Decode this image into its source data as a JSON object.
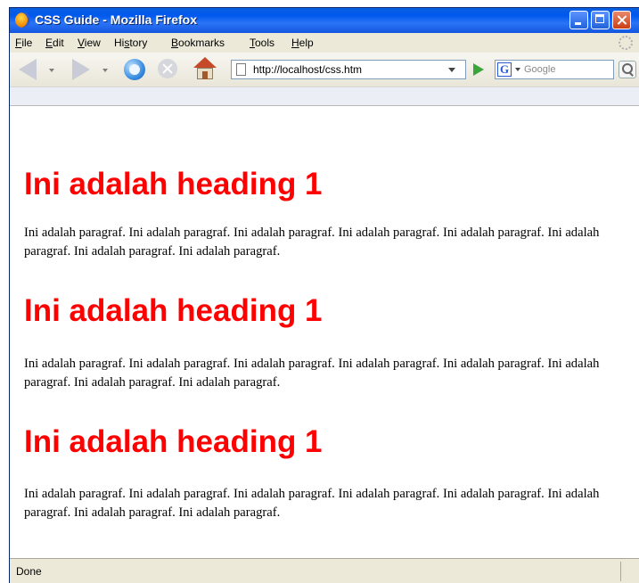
{
  "window": {
    "title": "CSS Guide - Mozilla Firefox"
  },
  "menubar": {
    "items": [
      {
        "key": "F",
        "rest": "ile"
      },
      {
        "key": "E",
        "rest": "dit"
      },
      {
        "key": "V",
        "rest": "iew"
      },
      {
        "pre": "Hi",
        "key": "s",
        "rest": "tory"
      },
      {
        "key": "B",
        "rest": "ookmarks"
      },
      {
        "key": "T",
        "rest": "ools"
      },
      {
        "key": "H",
        "rest": "elp"
      }
    ]
  },
  "navbar": {
    "url": "http://localhost/css.htm",
    "search_placeholder": "Google",
    "search_engine_letter": "G"
  },
  "content": {
    "sections": [
      {
        "heading": "Ini adalah heading 1",
        "paragraph": "Ini adalah paragraf. Ini adalah paragraf. Ini adalah paragraf. Ini adalah paragraf. Ini adalah paragraf. Ini adalah paragraf. Ini adalah paragraf. Ini adalah paragraf."
      },
      {
        "heading": "Ini adalah heading 1",
        "paragraph": "Ini adalah paragraf. Ini adalah paragraf. Ini adalah paragraf. Ini adalah paragraf. Ini adalah paragraf. Ini adalah paragraf. Ini adalah paragraf. Ini adalah paragraf."
      },
      {
        "heading": "Ini adalah heading 1",
        "paragraph": "Ini adalah paragraf. Ini adalah paragraf. Ini adalah paragraf. Ini adalah paragraf. Ini adalah paragraf. Ini adalah paragraf. Ini adalah paragraf. Ini adalah paragraf."
      }
    ],
    "heading_color": "#ff0000"
  },
  "statusbar": {
    "text": "Done"
  }
}
